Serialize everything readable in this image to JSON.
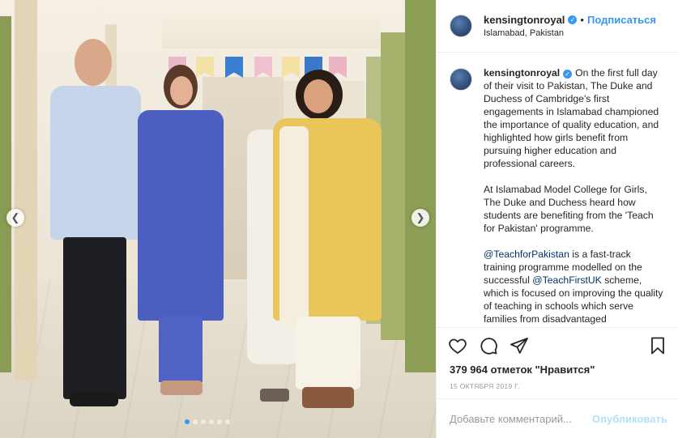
{
  "post": {
    "username": "kensingtonroyal",
    "location": "Islamabad, Pakistan",
    "follow_label": "Подписаться",
    "separator": "•",
    "caption_paragraphs": [
      "On the first full day of their visit to Pakistan, The Duke and Duchess of Cambridge's first engagements in Islamabad championed the importance of quality education, and highlighted how girls benefit from pursuing higher education and professional careers.",
      "At Islamabad Model College for Girls, The Duke and Duchess heard how students are benefiting from the 'Teach for Pakistan' programme."
    ],
    "caption_p3_mention1": "@TeachforPakistan",
    "caption_p3_text1": " is a fast-track training programme modelled on the successful ",
    "caption_p3_mention2": "@TeachFirstUK",
    "caption_p3_text2": " scheme, which is focused on improving the quality of teaching in schools which serve families from disadvantaged",
    "likes": "379 964 отметок \"Нравится\"",
    "date": "15 ОКТЯБРЯ 2019 Г.",
    "comment_placeholder": "Добавьте комментарий...",
    "publish_label": "Опубликовать"
  },
  "carousel": {
    "prev_icon": "chevron-left-icon",
    "next_icon": "chevron-right-icon",
    "dot_count": 6,
    "active_dot": 0
  },
  "icons": {
    "like": "heart-icon",
    "comment": "comment-bubble-icon",
    "share": "paper-plane-icon",
    "save": "bookmark-icon",
    "verified": "verified-badge-icon"
  },
  "colors": {
    "accent": "#3897f0",
    "publish_disabled": "#b2dffc",
    "muted": "#999999"
  }
}
